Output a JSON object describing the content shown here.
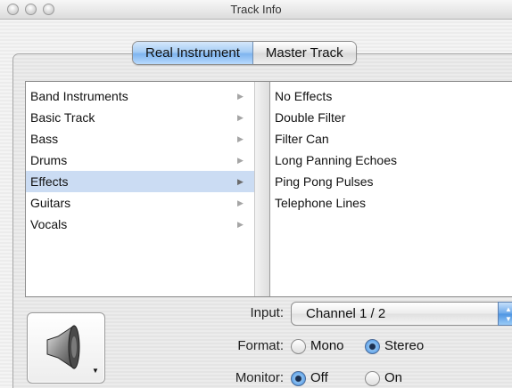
{
  "window": {
    "title": "Track Info"
  },
  "tabs": [
    {
      "label": "Real Instrument",
      "selected": true
    },
    {
      "label": "Master Track",
      "selected": false
    }
  ],
  "categories": [
    {
      "label": "Band Instruments",
      "selected": false
    },
    {
      "label": "Basic Track",
      "selected": false
    },
    {
      "label": "Bass",
      "selected": false
    },
    {
      "label": "Drums",
      "selected": false
    },
    {
      "label": "Effects",
      "selected": true
    },
    {
      "label": "Guitars",
      "selected": false
    },
    {
      "label": "Vocals",
      "selected": false
    }
  ],
  "presets": [
    "No Effects",
    "Double Filter",
    "Filter Can",
    "Long Panning Echoes",
    "Ping Pong Pulses",
    "Telephone Lines"
  ],
  "input": {
    "label": "Input:",
    "value": "Channel 1 / 2"
  },
  "format": {
    "label": "Format:",
    "options": [
      "Mono",
      "Stereo"
    ],
    "selected": "Stereo"
  },
  "monitor": {
    "label": "Monitor:",
    "options": [
      "Off",
      "On"
    ],
    "selected": "Off"
  },
  "icons": {
    "disclosure": "▶",
    "popup": "▲▼",
    "instrument": "speaker-icon",
    "menu_indicator": "▼"
  },
  "colors": {
    "selection": "#cbdcf3",
    "accent": "#4f97e3"
  }
}
